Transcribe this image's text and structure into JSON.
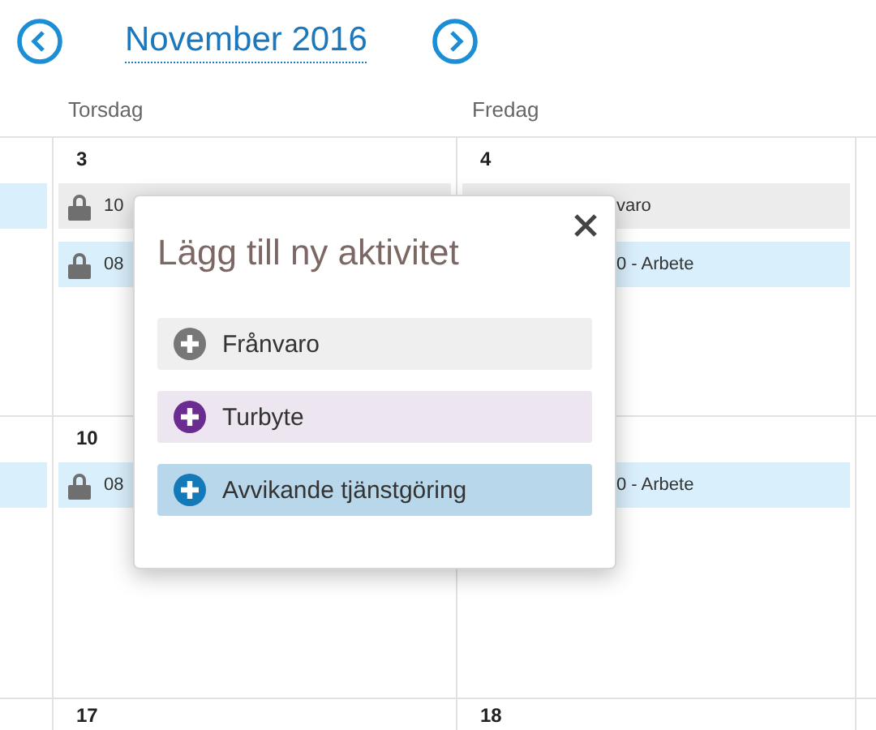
{
  "header": {
    "title": "November 2016"
  },
  "day_names": [
    "Torsdag",
    "Fredag"
  ],
  "weeks": [
    {
      "cells": [
        {
          "events": [
            {
              "kind": "work"
            }
          ]
        },
        {
          "day": "3",
          "events": [
            {
              "kind": "absence",
              "locked": true,
              "text": "10"
            },
            {
              "kind": "work",
              "locked": true,
              "text": "08"
            }
          ]
        },
        {
          "day": "4",
          "events": [
            {
              "kind": "absence",
              "text": "varo"
            },
            {
              "kind": "work",
              "text": "0 - Arbete"
            }
          ]
        },
        {}
      ]
    },
    {
      "cells": [
        {
          "events": [
            {
              "kind": "work"
            }
          ]
        },
        {
          "day": "10",
          "events": [
            {
              "kind": "work",
              "locked": true,
              "text": "08"
            }
          ]
        },
        {
          "events": [
            {
              "kind": "work",
              "text": "0 - Arbete"
            }
          ]
        },
        {}
      ]
    },
    {
      "cells": [
        {},
        {
          "day": "17"
        },
        {
          "day": "18"
        },
        {}
      ]
    }
  ],
  "dialog": {
    "title": "Lägg till ny aktivitet",
    "options": [
      {
        "kind": "absence",
        "label": "Frånvaro"
      },
      {
        "kind": "shift-swap",
        "label": "Turbyte"
      },
      {
        "kind": "deviation",
        "label": "Avvikande tjänstgöring"
      }
    ]
  }
}
